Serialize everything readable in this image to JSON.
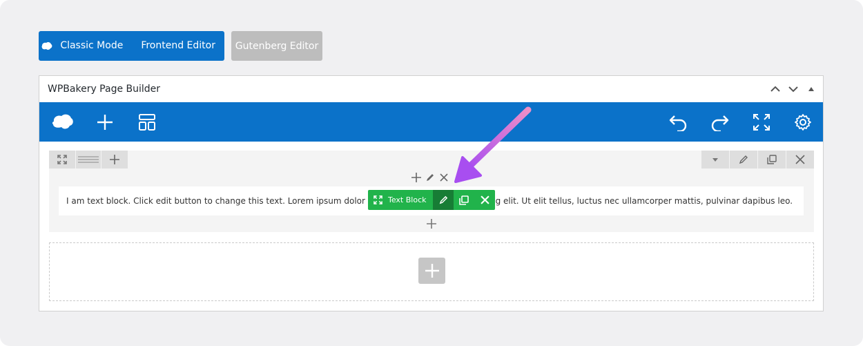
{
  "mode_bar": {
    "classic_label": "Classic Mode",
    "frontend_label": "Frontend Editor",
    "gutenberg_label": "Gutenberg Editor"
  },
  "panel": {
    "title": "WPBakery Page Builder"
  },
  "toolbar": {
    "icons": [
      "wpbakery-logo-icon",
      "add-element-icon",
      "templates-icon",
      "undo-icon",
      "redo-icon",
      "fullscreen-icon",
      "settings-icon"
    ]
  },
  "text_block": {
    "content": "I am text block. Click edit button to change this text. Lorem ipsum dolor sit amet, consectetur adipiscing elit. Ut elit tellus, luctus nec ullamcorper mattis, pulvinar dapibus leo.",
    "controls_label": "Text Block"
  },
  "colors": {
    "brand_blue": "#0b72c9",
    "element_green": "#21b34b",
    "element_green_active": "#177d35",
    "arrow": "#c46be0"
  }
}
